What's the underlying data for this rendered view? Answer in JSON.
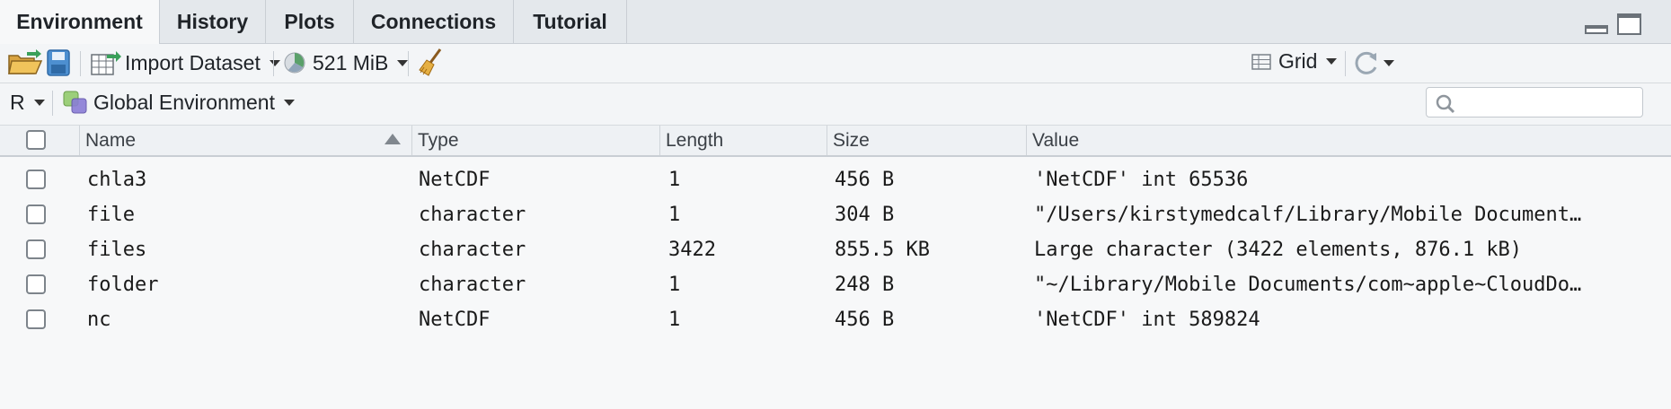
{
  "tabs": [
    {
      "label": "Environment",
      "active": true
    },
    {
      "label": "History"
    },
    {
      "label": "Plots"
    },
    {
      "label": "Connections"
    },
    {
      "label": "Tutorial"
    }
  ],
  "toolbar": {
    "import_label": "Import Dataset",
    "memory_label": "521 MiB",
    "view_label": "Grid"
  },
  "toolbar2": {
    "language_label": "R",
    "env_label": "Global Environment",
    "search_placeholder": ""
  },
  "table": {
    "headers": {
      "name": "Name",
      "type": "Type",
      "length": "Length",
      "size": "Size",
      "value": "Value"
    },
    "rows": [
      {
        "name": "chla3",
        "type": "NetCDF",
        "length": "1",
        "size": "456 B",
        "value": "'NetCDF' int 65536"
      },
      {
        "name": "file",
        "type": "character",
        "length": "1",
        "size": "304 B",
        "value": "\"/Users/kirstymedcalf/Library/Mobile Document…"
      },
      {
        "name": "files",
        "type": "character",
        "length": "3422",
        "size": "855.5 KB",
        "value": "Large character (3422 elements, 876.1 kB)"
      },
      {
        "name": "folder",
        "type": "character",
        "length": "1",
        "size": "248 B",
        "value": "\"~/Library/Mobile Documents/com~apple~CloudDo…"
      },
      {
        "name": "nc",
        "type": "NetCDF",
        "length": "1",
        "size": "456 B",
        "value": "'NetCDF' int 589824"
      }
    ]
  },
  "colors": {
    "accent": "#3f82c4",
    "broom": "#c98a2e"
  }
}
